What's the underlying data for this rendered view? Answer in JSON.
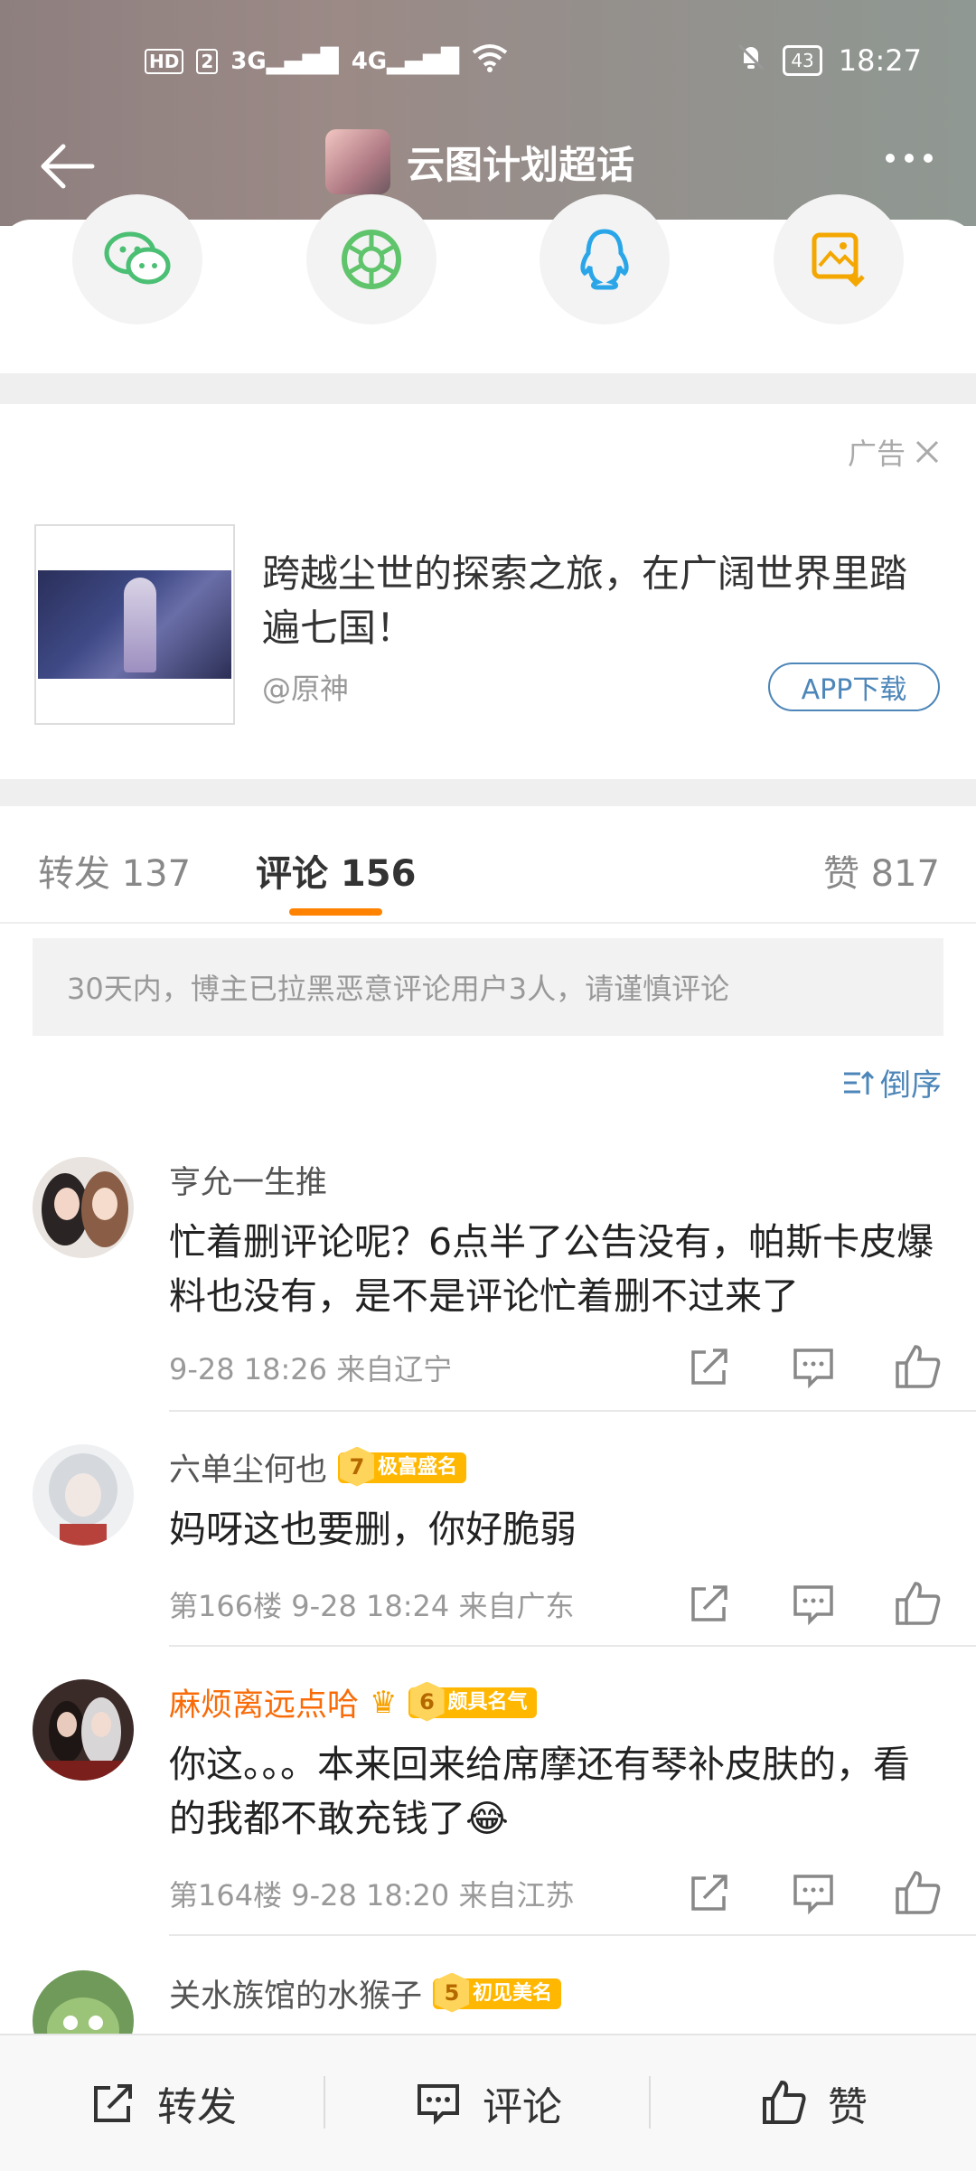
{
  "status_bar": {
    "left": [
      "HD",
      "2",
      "3G",
      "4G"
    ],
    "battery": "43",
    "time": "18:27"
  },
  "header": {
    "title": "云图计划超话"
  },
  "share": {
    "items": [
      "wechat-icon",
      "moments-icon",
      "qq-icon",
      "save-image-icon"
    ]
  },
  "ad": {
    "tag": "广告",
    "title": "跨越尘世的探索之旅，在广阔世界里踏遍七国！",
    "source": "@原神",
    "button": "APP下载"
  },
  "tabs": {
    "repost": "转发 137",
    "comment": "评论 156",
    "like": "赞 817"
  },
  "notice": "30天内，博主已拉黑恶意评论用户3人，请谨慎评论",
  "sort_label": "倒序",
  "comments": [
    {
      "name": "亨允一生推",
      "text": "忙着删评论呢？6点半了公告没有，帕斯卡皮爆料也没有，是不是评论忙着删不过来了",
      "meta": "9-28 18:26  来自辽宁"
    },
    {
      "name": "六单尘何也",
      "badge_level": "7",
      "badge_text": "极富盛名",
      "text": "妈呀这也要删，你好脆弱",
      "meta": "第166楼  9-28 18:24  来自广东"
    },
    {
      "name": "麻烦离远点哈",
      "badge_level": "6",
      "badge_text": "颇具名气",
      "text": "你这。。。本来回来给席摩还有琴补皮肤的，看的我都不敢充钱了😂",
      "meta": "第164楼  9-28 18:20  来自江苏"
    },
    {
      "name": "关水族馆的水猴子",
      "badge_level": "5",
      "badge_text": "初见美名"
    }
  ],
  "bottom_bar": {
    "repost": "转发",
    "comment": "评论",
    "like": "赞"
  },
  "colors": {
    "accent_orange": "#ff8200",
    "link_blue": "#4d86b8",
    "vip_name": "#f86b08"
  }
}
